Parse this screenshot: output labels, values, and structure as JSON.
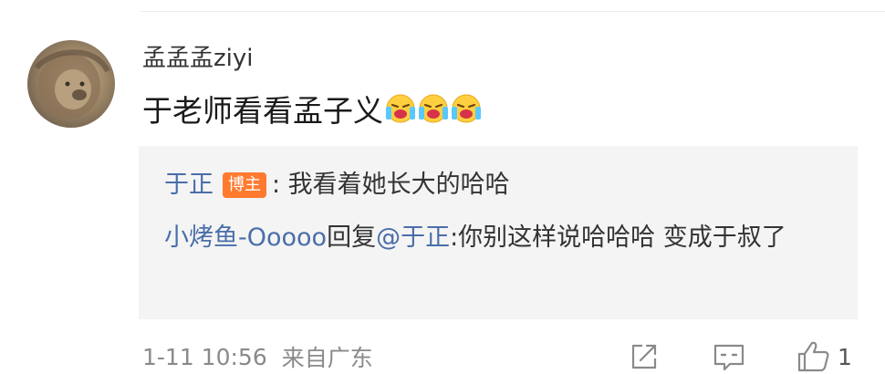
{
  "comment": {
    "username": "孟孟孟ziyi",
    "text": "于老师看看孟子义",
    "emojis": [
      "crying-laughing-emoji",
      "crying-laughing-emoji",
      "crying-laughing-emoji"
    ],
    "timestamp": "1-11 10:56",
    "location": "来自广东",
    "like_count": "1"
  },
  "replies": [
    {
      "author": "于正",
      "badge": "博主",
      "text": ": 我看着她长大的哈哈"
    },
    {
      "author": "小烤鱼-Ooooo",
      "reply_word": "回复",
      "mention": "@于正",
      "text": ":你别这样说哈哈哈 变成于叔了"
    }
  ],
  "colors": {
    "link": "#4a6ea9",
    "badge": "#ff7a2f",
    "reply_bg": "#f4f4f4"
  },
  "icons": [
    "share-icon",
    "reply-icon",
    "like-icon"
  ]
}
